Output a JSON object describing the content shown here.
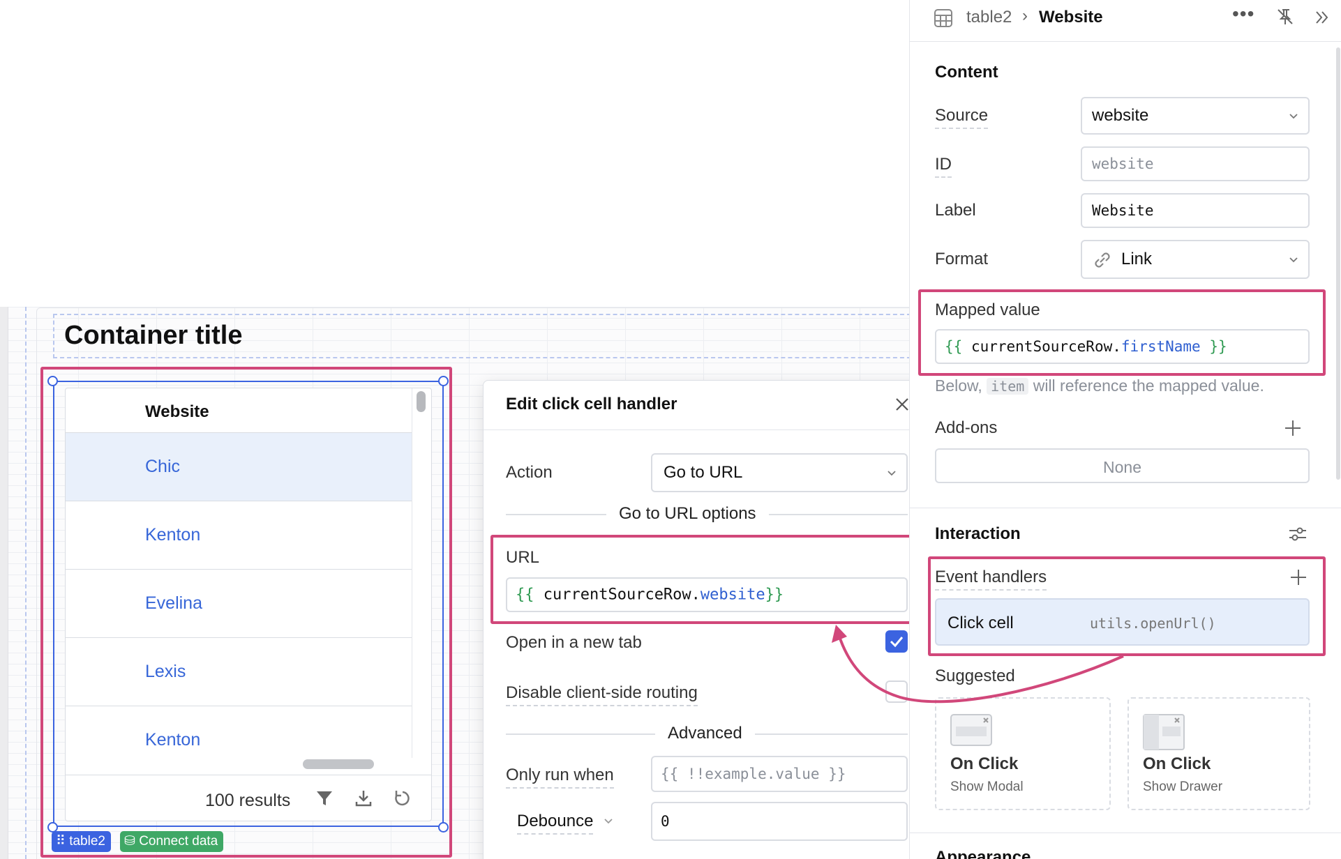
{
  "canvas": {
    "container_title": "Container title",
    "table": {
      "column_header": "Website",
      "rows": [
        "Chic",
        "Kenton",
        "Evelina",
        "Lexis",
        "Kenton"
      ],
      "results": "100 results",
      "badge_name": "table2",
      "connect_label": "Connect data"
    }
  },
  "dialog": {
    "title": "Edit click cell handler",
    "action_label": "Action",
    "action_value": "Go to URL",
    "options_divider": "Go to URL options",
    "url_label": "URL",
    "url_open": "{{ ",
    "url_obj": "currentSourceRow",
    "url_dot": ".",
    "url_prop": "website",
    "url_close": "}}",
    "new_tab_label": "Open in a new tab",
    "new_tab_checked": true,
    "disable_routing_label": "Disable client-side routing",
    "disable_routing_checked": false,
    "advanced_divider": "Advanced",
    "only_run_label": "Only run when",
    "only_run_placeholder": "{{ !!example.value }}",
    "debounce_label": "Debounce",
    "debounce_value": "0"
  },
  "inspector": {
    "breadcrumb_parent": "table2",
    "breadcrumb_current": "Website",
    "content_title": "Content",
    "source_label": "Source",
    "source_value": "website",
    "id_label": "ID",
    "id_placeholder": "website",
    "label_label": "Label",
    "label_value": "Website",
    "format_label": "Format",
    "format_value": "Link",
    "mapped_label": "Mapped value",
    "mapped_open": "{{ ",
    "mapped_obj": "currentSourceRow",
    "mapped_dot": ".",
    "mapped_prop": "firstName",
    "mapped_close": " }}",
    "below_pre": "Below, ",
    "below_code": "item",
    "below_post": " will reference the mapped value.",
    "addons_label": "Add-ons",
    "addons_value": "None",
    "interaction_title": "Interaction",
    "event_handlers_label": "Event handlers",
    "handler_event": "Click cell",
    "handler_method": "utils.openUrl()",
    "suggested_label": "Suggested",
    "suggestions": [
      {
        "title": "On Click",
        "subtitle": "Show Modal"
      },
      {
        "title": "On Click",
        "subtitle": "Show Drawer"
      }
    ],
    "appearance_title": "Appearance"
  },
  "colors": {
    "highlight": "#d1477a",
    "selection": "#3b63e0",
    "link": "#3766d8"
  }
}
